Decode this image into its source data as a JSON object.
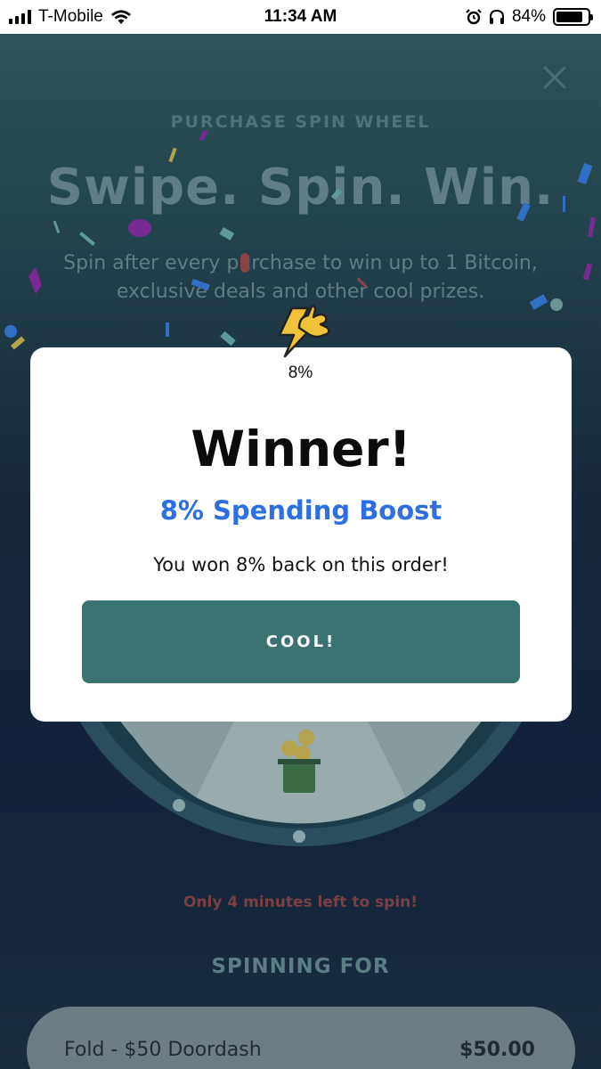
{
  "status_bar": {
    "carrier": "T-Mobile",
    "time": "11:34 AM",
    "battery_percent": "84%",
    "battery_level": 0.84,
    "icons": [
      "signal-icon",
      "wifi-icon",
      "alarm-icon",
      "headphones-icon",
      "battery-icon"
    ]
  },
  "background": {
    "subtitle": "PURCHASE SPIN WHEEL",
    "title": "Swipe. Spin. Win.",
    "description": "Spin after every purchase to win up to 1 Bitcoin, exclusive deals and other cool prizes.",
    "timer_text": "Only 4 minutes left to spin!",
    "spinning_for_label": "SPINNING FOR",
    "order": {
      "name": "Fold - $50 Doordash",
      "amount": "$50.00"
    }
  },
  "modal": {
    "badge_label": "8%",
    "badge_icon": "lightning-hand-icon",
    "title": "Winner!",
    "prize": "8% Spending Boost",
    "message": "You won 8% back on this order!",
    "button_label": "COOL!"
  },
  "colors": {
    "accent_button": "#3a7472",
    "prize_blue": "#2e6fe0",
    "timer_red": "#7a3f43"
  }
}
